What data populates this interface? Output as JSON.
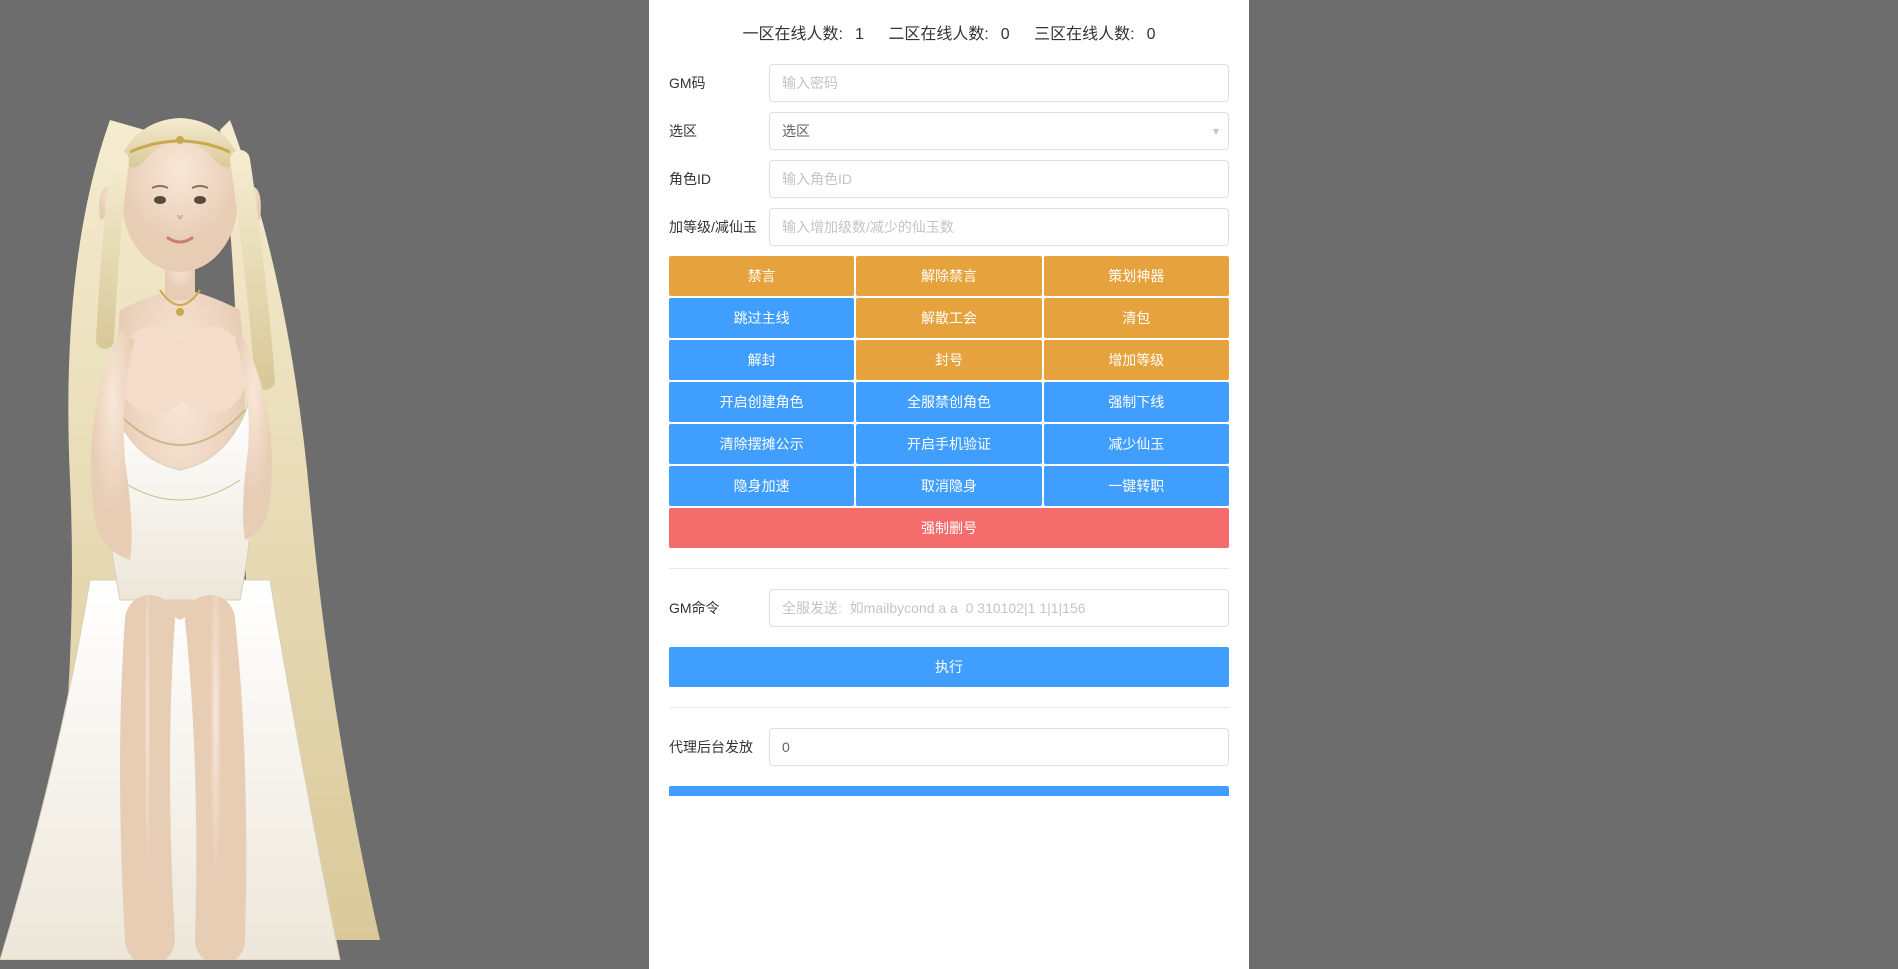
{
  "header": {
    "zone1_label": "一区在线人数:",
    "zone1_count": "1",
    "zone2_label": "二区在线人数:",
    "zone2_count": "0",
    "zone3_label": "三区在线人数:",
    "zone3_count": "0"
  },
  "fields": {
    "gm_code_label": "GM码",
    "gm_code_placeholder": "输入密码",
    "zone_label": "选区",
    "zone_value": "选区",
    "role_id_label": "角色ID",
    "role_id_placeholder": "输入角色ID",
    "level_label": "加等级/减仙玉",
    "level_placeholder": "输入增加级数/减少的仙玉数",
    "gm_cmd_label": "GM命令",
    "gm_cmd_placeholder": "全服发送:  如mailbycond a a  0 310102|1 1|1|156",
    "agent_label": "代理后台发放",
    "agent_value": "0"
  },
  "buttons": {
    "mute": "禁言",
    "unmute": "解除禁言",
    "plan_artifact": "策划神器",
    "skip_main": "跳过主线",
    "dissolve_guild": "解散工会",
    "clear_bag": "清包",
    "unban": "解封",
    "ban": "封号",
    "add_level": "增加等级",
    "open_create": "开启创建角色",
    "global_ban_create": "全服禁创角色",
    "force_offline": "强制下线",
    "clear_stall": "清除摆摊公示",
    "open_phone": "开启手机验证",
    "reduce_jade": "减少仙玉",
    "stealth_speed": "隐身加速",
    "cancel_stealth": "取消隐身",
    "one_key_transfer": "一键转职",
    "force_delete": "强制删号",
    "execute": "执行"
  }
}
